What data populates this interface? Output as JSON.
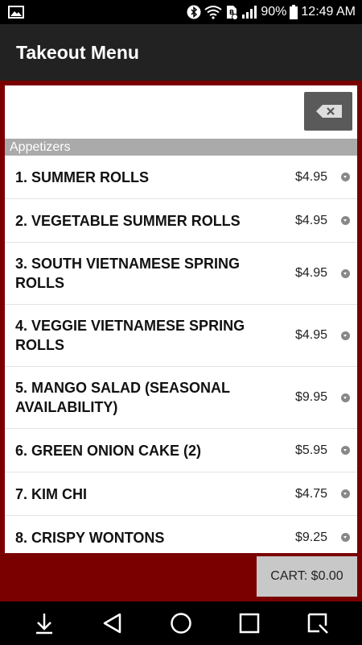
{
  "status_bar": {
    "battery": "90%",
    "time": "12:49 AM"
  },
  "app_bar": {
    "title": "Takeout Menu"
  },
  "search": {
    "value": ""
  },
  "section": {
    "title": "Appetizers"
  },
  "menu_items": [
    {
      "name": "1. SUMMER ROLLS",
      "price": "$4.95"
    },
    {
      "name": "2. VEGETABLE SUMMER ROLLS",
      "price": "$4.95"
    },
    {
      "name": "3. SOUTH VIETNAMESE SPRING ROLLS",
      "price": "$4.95"
    },
    {
      "name": "4. VEGGIE VIETNAMESE SPRING ROLLS",
      "price": "$4.95"
    },
    {
      "name": "5. MANGO SALAD (SEASONAL AVAILABILITY)",
      "price": "$9.95"
    },
    {
      "name": "6. GREEN ONION CAKE (2)",
      "price": "$5.95"
    },
    {
      "name": "7. KIM CHI",
      "price": "$4.75"
    },
    {
      "name": "8. CRISPY WONTONS",
      "price": "$9.25"
    }
  ],
  "cart": {
    "label": "CART: $0.00"
  },
  "icons": {
    "status_left": "gallery-icon",
    "status_right": [
      "bluetooth-icon",
      "wifi-icon",
      "nfc-icon",
      "signal-icon",
      "battery-icon"
    ],
    "backspace": "backspace-icon",
    "nav": [
      "download-icon",
      "back-icon",
      "home-icon",
      "recents-icon",
      "capture-icon"
    ]
  },
  "colors": {
    "app_bar": "#222222",
    "content_bg": "#7a0000",
    "section_header": "#aaaaaa",
    "cart_button": "#c8c8c8"
  }
}
